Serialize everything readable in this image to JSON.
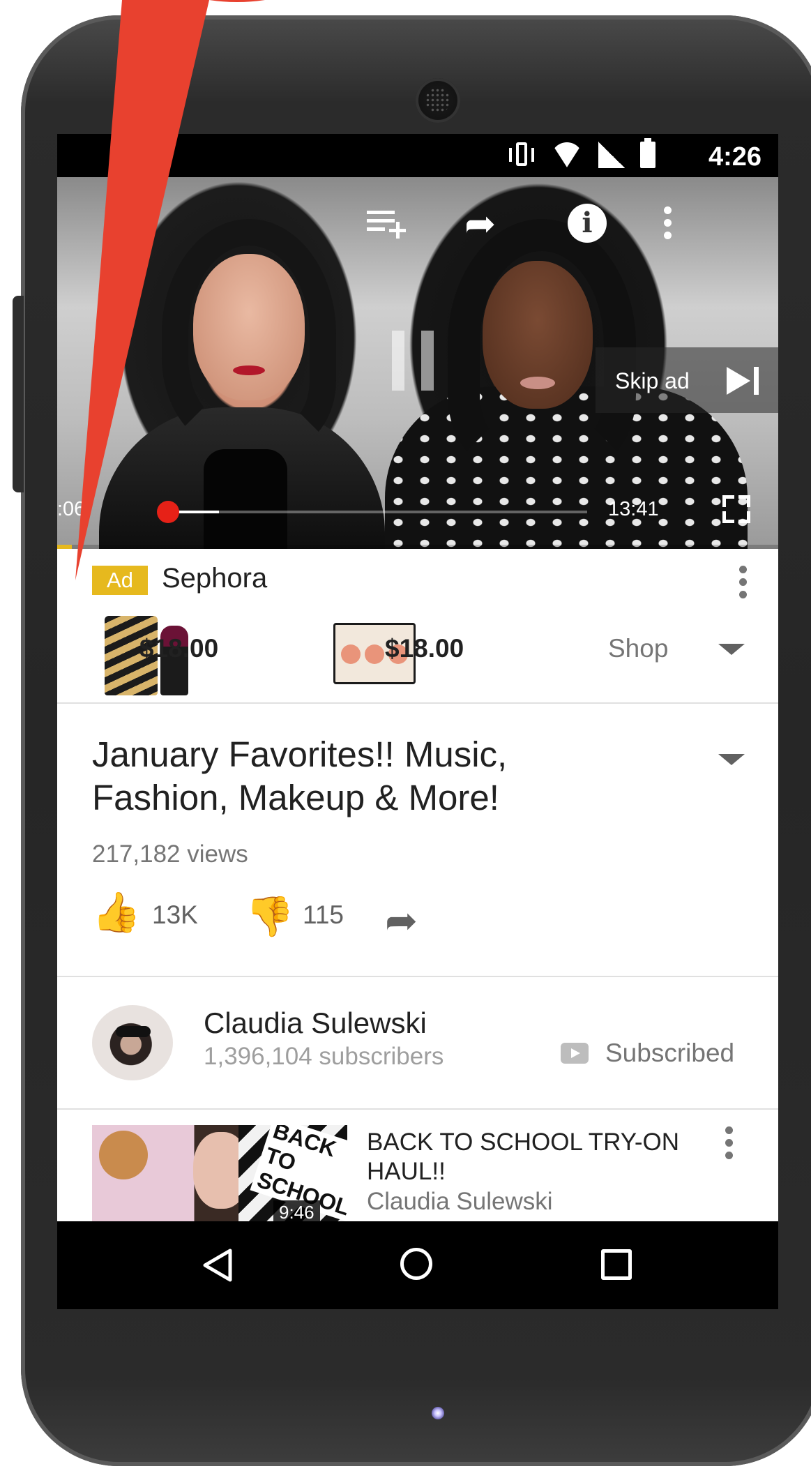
{
  "status_bar": {
    "time": "4:26"
  },
  "video": {
    "skip_label": "Skip ad",
    "elapsed": ":06",
    "total": "13:41",
    "ad_progress": 0.02,
    "buffer_progress": 0.12
  },
  "ad": {
    "badge": "Ad",
    "brand": "Sephora",
    "products": [
      {
        "price": "$18.00"
      },
      {
        "price": "$18.00"
      }
    ],
    "shop_label": "Shop"
  },
  "details": {
    "title": "January Favorites!! Music, Fashion, Makeup & More!",
    "views": "217,182 views",
    "likes": "13K",
    "dislikes": "115"
  },
  "channel": {
    "name": "Claudia Sulewski",
    "subscribers": "1,396,104 subscribers",
    "subscribe_label": "Subscribed"
  },
  "recommended": [
    {
      "title": "BACK TO SCHOOL TRY-ON HAUL!!",
      "channel": "Claudia Sulewski",
      "thumb_text": "BACK TO SCHOOL",
      "duration": "9:46"
    }
  ],
  "colors": {
    "accent_red": "#e62117",
    "ad_yellow": "#e6b91e",
    "annotation_red": "#e8412f"
  }
}
